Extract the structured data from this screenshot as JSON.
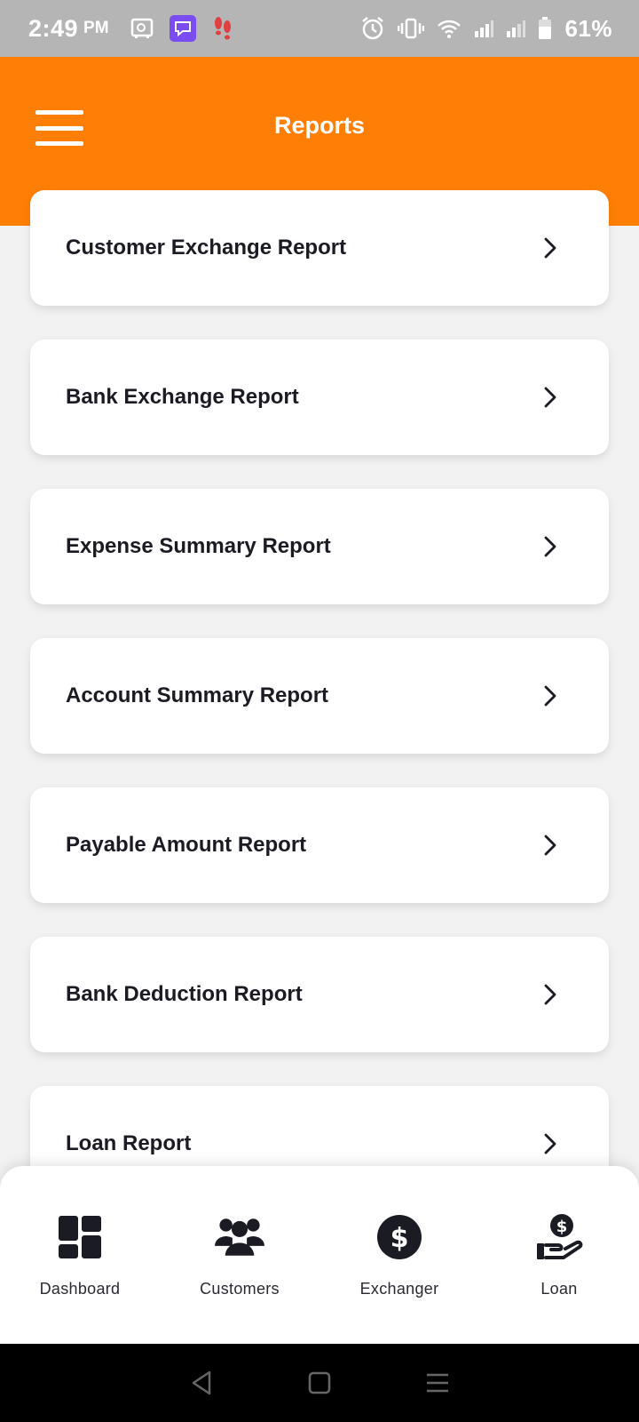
{
  "status_bar": {
    "time": "2:49",
    "ampm": "PM",
    "battery_percent": "61%",
    "left_icons": [
      "safe-icon",
      "chat-app-icon",
      "footsteps-icon"
    ],
    "right_icons": [
      "alarm-icon",
      "vibrate-icon",
      "wifi-icon",
      "signal-icon",
      "signal-icon",
      "battery-icon"
    ]
  },
  "header": {
    "title": "Reports",
    "menu_icon": "hamburger-menu-icon",
    "background_color": "#ff7f06"
  },
  "reports": [
    {
      "label": "Customer Exchange Report"
    },
    {
      "label": "Bank Exchange Report"
    },
    {
      "label": "Expense Summary Report"
    },
    {
      "label": "Account Summary Report"
    },
    {
      "label": "Payable Amount Report"
    },
    {
      "label": "Bank Deduction Report"
    },
    {
      "label": "Loan Report"
    }
  ],
  "bottom_nav": {
    "items": [
      {
        "label": "Dashboard",
        "icon": "dashboard-icon"
      },
      {
        "label": "Customers",
        "icon": "users-icon"
      },
      {
        "label": "Exchanger",
        "icon": "dollar-icon"
      },
      {
        "label": "Loan",
        "icon": "loan-hand-icon"
      }
    ]
  },
  "system_nav": {
    "buttons": [
      "back-icon",
      "home-icon",
      "recents-icon"
    ]
  }
}
